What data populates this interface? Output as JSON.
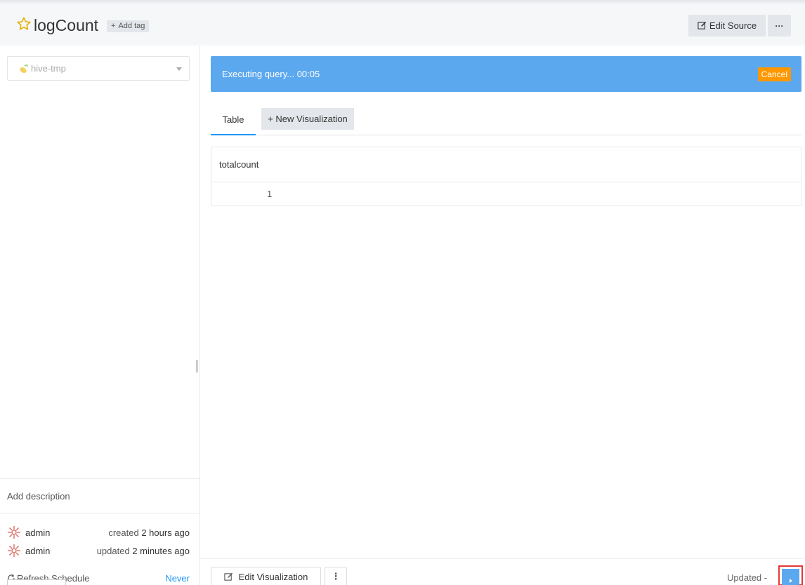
{
  "header": {
    "title": "logCount",
    "add_tag": "Add tag",
    "add_tag_plus": "+",
    "edit_source": "Edit Source",
    "more": "···"
  },
  "sidebar": {
    "datasource": "hive-tmp",
    "add_description": "Add description",
    "created": {
      "user": "admin",
      "prefix": "created",
      "time": "2 hours ago"
    },
    "updated": {
      "user": "admin",
      "prefix": "updated",
      "time": "2 minutes ago"
    },
    "refresh_schedule": "Refresh Schedule",
    "refresh_value": "Never"
  },
  "main": {
    "exec_status": "Executing query... 00:05",
    "cancel": "Cancel",
    "tabs": [
      "Table",
      "+ New Visualization"
    ],
    "table": {
      "columns": [
        "totalcount"
      ],
      "rows": [
        [
          "1"
        ]
      ]
    }
  },
  "footer": {
    "edit_visualization": "Edit Visualization",
    "more": "⋮",
    "updated": "Updated -"
  },
  "colors": {
    "accent": "#2196f3",
    "banner": "#5ba8ef",
    "cancel": "#ff9800",
    "highlight": "#e53935"
  },
  "icons": [
    "star-icon",
    "database-icon",
    "caret-down-icon",
    "edit-icon",
    "avatar-icon",
    "refresh-icon",
    "play-icon"
  ]
}
